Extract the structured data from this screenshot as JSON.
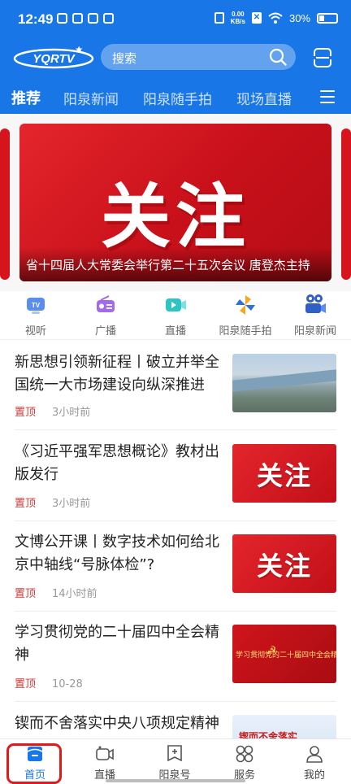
{
  "status_bar": {
    "time": "12:49",
    "net_speed_value": "0.00",
    "net_speed_unit": "KB/s",
    "battery": "30%"
  },
  "header": {
    "logo_text": "YQRTV",
    "search_placeholder": "搜索"
  },
  "tabs": [
    "推荐",
    "阳泉新闻",
    "阳泉随手拍",
    "现场直播"
  ],
  "banner": {
    "image_text": "关注",
    "caption": "省十四届人大常委会举行第二十五次会议 唐登杰主持"
  },
  "quick_links": [
    {
      "label": "视听",
      "icon": "tv-icon"
    },
    {
      "label": "广播",
      "icon": "radio-icon"
    },
    {
      "label": "直播",
      "icon": "live-camera-icon"
    },
    {
      "label": "阳泉随手拍",
      "icon": "pinwheel-icon"
    },
    {
      "label": "阳泉新闻",
      "icon": "news-camera-icon"
    }
  ],
  "news": [
    {
      "title": "新思想引领新征程丨破立并举全国统一大市场建设向纵深推进",
      "tag": "置顶",
      "time": "3小时前",
      "thumb": "city-aerial"
    },
    {
      "title": "《习近平强军思想概论》教材出版发行",
      "tag": "置顶",
      "time": "3小时前",
      "thumb": "关注"
    },
    {
      "title": "文博公开课丨数字技术如何给北京中轴线“号脉体检”?",
      "tag": "置顶",
      "time": "14小时前",
      "thumb": "关注"
    },
    {
      "title": "学习贯彻党的二十届四中全会精神",
      "tag": "置顶",
      "time": "10-28",
      "thumb": "学习贯彻党的二十届四中全会精神"
    },
    {
      "title": "锲而不舍落实中央八项规定精神",
      "tag": "",
      "time": "",
      "thumb": "锲而不舍落实"
    }
  ],
  "bottom_nav": [
    "首页",
    "直播",
    "阳泉号",
    "服务",
    "我的"
  ],
  "colors": {
    "brand_blue": "#1976e6",
    "accent_red": "#d5141c",
    "highlight_border": "#e01a1a"
  }
}
